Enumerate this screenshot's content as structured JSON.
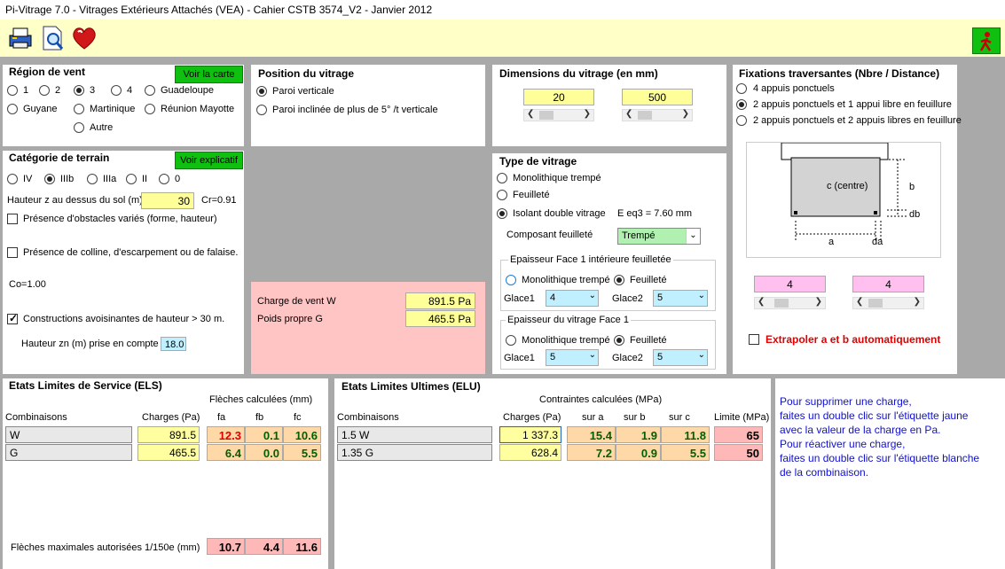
{
  "window": {
    "title": "Pi-Vitrage 7.0 - Vitrages Extérieurs Attachés (VEA) - Cahier CSTB 3574_V2 - Janvier 2012"
  },
  "toolbar": {
    "icons": [
      "printer-icon",
      "print-preview-icon",
      "heart-icon",
      "exit-icon"
    ]
  },
  "region_vent": {
    "title": "Région de vent",
    "map_button": "Voir la carte",
    "options": [
      "1",
      "2",
      "3",
      "4",
      "Guadeloupe",
      "Guyane",
      "Martinique",
      "Réunion Mayotte",
      "Autre"
    ],
    "selected": "3"
  },
  "position_vitrage": {
    "title": "Position du vitrage",
    "options": [
      "Paroi verticale",
      "Paroi inclinée de plus de 5° /t verticale"
    ],
    "selected": "Paroi verticale"
  },
  "dimensions": {
    "title": "Dimensions du vitrage (en mm)",
    "a_value": "20",
    "b_value": "500"
  },
  "fixations": {
    "title": "Fixations traversantes (Nbre / Distance)",
    "options": [
      "4 appuis ponctuels",
      "2 appuis ponctuels et 1 appui libre en feuillure",
      "2 appuis ponctuels et 2 appuis libres en feuillure"
    ],
    "selected": "2 appuis ponctuels et 1 appui libre en feuillure",
    "diagram_labels": {
      "center": "c (centre)",
      "b": "b",
      "db": "db",
      "a": "a",
      "da": "da"
    },
    "a_value": "4",
    "b_value": "4",
    "extrapolate_label": "Extrapoler a et b automatiquement",
    "extrapolate_checked": false
  },
  "categorie_terrain": {
    "title": "Catégorie de terrain",
    "explain_button": "Voir explicatif",
    "options": [
      "IV",
      "IIIb",
      "IIIa",
      "II",
      "0"
    ],
    "selected": "IIIb",
    "hauteur_label": "Hauteur z au dessus du sol (m)",
    "hauteur_value": "30",
    "cr_label": "Cr=0.91",
    "obstacles_label": "Présence d'obstacles variés (forme, hauteur)",
    "obstacles_checked": false,
    "colline_label": "Présence de colline, d'escarpement ou de falaise.",
    "colline_checked": false,
    "co_label": "Co=1.00",
    "constructions_label": "Constructions avoisinantes de hauteur > 30 m.",
    "constructions_checked": true,
    "hauteur_zn_label": "Hauteur zn (m) prise en compte",
    "hauteur_zn_value": "18.0"
  },
  "charges": {
    "vent_label": "Charge de vent W",
    "vent_value": "891.5 Pa",
    "poids_label": "Poids propre G",
    "poids_value": "465.5 Pa"
  },
  "type_vitrage": {
    "title": "Type de vitrage",
    "options": [
      "Monolithique trempé",
      "Feuilleté",
      "Isolant double vitrage"
    ],
    "selected": "Isolant double vitrage",
    "eeq_label": "E eq3 = 7.60 mm",
    "composant_label": "Composant feuilleté",
    "composant_value": "Trempé",
    "face1_int": {
      "legend": "Epaisseur Face 1 intérieure feuilletée",
      "options": [
        "Monolithique trempé",
        "Feuilleté"
      ],
      "selected": "Feuilleté",
      "glace1_label": "Glace1",
      "glace1_value": "4",
      "glace2_label": "Glace2",
      "glace2_value": "5"
    },
    "face1": {
      "legend": "Epaisseur du vitrage Face 1",
      "options": [
        "Monolithique trempé",
        "Feuilleté"
      ],
      "selected": "Feuilleté",
      "glace1_label": "Glace1",
      "glace1_value": "5",
      "glace2_label": "Glace2",
      "glace2_value": "5"
    }
  },
  "els": {
    "title": "Etats Limites de Service (ELS)",
    "subtitle": "Flèches calculées (mm)",
    "headers": [
      "Combinaisons",
      "Charges (Pa)",
      "fa",
      "fb",
      "fc"
    ],
    "rows": [
      {
        "name": "W",
        "charge": "891.5",
        "fa": "12.3",
        "fb": "0.1",
        "fc": "10.6"
      },
      {
        "name": "G",
        "charge": "465.5",
        "fa": "6.4",
        "fb": "0.0",
        "fc": "5.5"
      }
    ],
    "max_label": "Flèches maximales autorisées 1/150e (mm)",
    "max_values": [
      "10.7",
      "4.4",
      "11.6"
    ]
  },
  "elu": {
    "title": "Etats Limites Ultimes (ELU)",
    "subtitle": "Contraintes calculées (MPa)",
    "headers": [
      "Combinaisons",
      "Charges (Pa)",
      "sur a",
      "sur b",
      "sur c",
      "Limite (MPa)"
    ],
    "rows": [
      {
        "name": "1.5 W",
        "charge": "1 337.3",
        "a": "15.4",
        "b": "1.9",
        "c": "11.8",
        "limite": "65"
      },
      {
        "name": "1.35 G",
        "charge": "628.4",
        "a": "7.2",
        "b": "0.9",
        "c": "5.5",
        "limite": "50"
      }
    ]
  },
  "help_note": {
    "lines": [
      "Pour supprimer une charge,",
      "faites un double clic sur l'étiquette jaune",
      "avec la valeur de la charge en Pa.",
      "Pour réactiver une charge,",
      "faites un double clic sur l'étiquette blanche",
      "de la combinaison."
    ]
  },
  "colors": {
    "accent_green": "#10c010",
    "toolbar_bg": "#ffffc8",
    "alert_red": "#e00000",
    "note_blue": "#1010d0"
  }
}
